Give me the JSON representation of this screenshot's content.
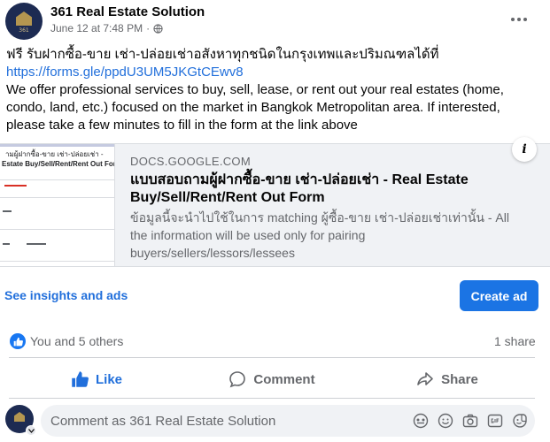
{
  "post": {
    "page_name": "361 Real Estate Solution",
    "timestamp": "June 12 at 7:48 PM",
    "separator": "·",
    "text_thai": "ฟรี รับฝากซื้อ-ขาย เช่า-ปล่อยเช่าอสังหาทุกชนิดในกรุงเทพและปริมณฑลได้ที่",
    "link": "https://forms.gle/ppdU3UM5JKGtCEwv8",
    "text_english": "We offer professional services to buy, sell, lease, or rent out your real estates (home, condo, land, etc.) focused on the market in Bangkok Metropolitan area. If interested, please take a few minutes to fill in the form at the link above"
  },
  "link_card": {
    "domain": "DOCS.GOOGLE.COM",
    "title": "แบบสอบถามผู้ฝากซื้อ-ขาย เช่า-ปล่อยเช่า - Real Estate Buy/Sell/Rent/Rent Out Form",
    "description": "ข้อมูลนี้จะนำไปใช้ในการ matching ผู้ซื้อ-ขาย เช่า-ปล่อยเช่าเท่านั้น - All the information will be used only for pairing buyers/sellers/lessors/lessees",
    "thumbnail_title": "ามผู้ฝากซื้อ-ขาย เช่า-ปล่อยเช่า -",
    "thumbnail_subtitle": "Estate Buy/Sell/Rent/Rent Out Form",
    "info_label": "i"
  },
  "insights": {
    "link_label": "See insights and ads",
    "create_ad_label": "Create ad"
  },
  "reactions": {
    "count_text": "You and 5 others",
    "shares_text": "1 share"
  },
  "actions": {
    "like": "Like",
    "comment": "Comment",
    "share": "Share"
  },
  "comment": {
    "placeholder": "Comment as 361 Real Estate Solution"
  },
  "avatar_text": "361",
  "colors": {
    "accent": "#1b74e4",
    "link": "#216fdb",
    "secondary_text": "#65676b",
    "card_background": "#f0f2f5"
  },
  "icons": [
    "globe-icon",
    "more-options-icon",
    "info-icon",
    "like-reaction-icon",
    "thumbs-up-icon",
    "comment-icon",
    "share-icon",
    "avatar-switch-icon",
    "avatar-icon",
    "emoji-icon",
    "camera-icon",
    "gif-icon",
    "sticker-icon"
  ]
}
